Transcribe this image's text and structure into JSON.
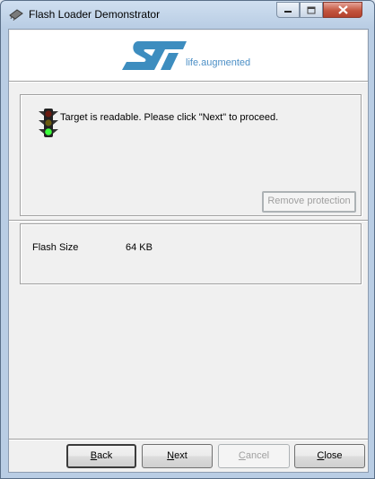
{
  "window": {
    "title": "Flash Loader Demonstrator"
  },
  "banner": {
    "brand": "ST",
    "tagline": "life.augmented",
    "colors": {
      "brand_blue": "#3d8dbf",
      "tagline_blue": "#4c8fc6"
    }
  },
  "status": {
    "icon": "traffic-light-icon",
    "message": "Target is readable. Please click \"Next\" to proceed.",
    "remove_protection_label": "Remove protection"
  },
  "info": {
    "flash_size_label": "Flash Size",
    "flash_size_value": "64 KB"
  },
  "buttons": {
    "back": {
      "accel": "B",
      "rest": "ack"
    },
    "next": {
      "accel": "N",
      "rest": "ext"
    },
    "cancel": {
      "accel": "C",
      "rest": "ancel"
    },
    "close": {
      "accel": "C",
      "rest": "lose"
    }
  }
}
